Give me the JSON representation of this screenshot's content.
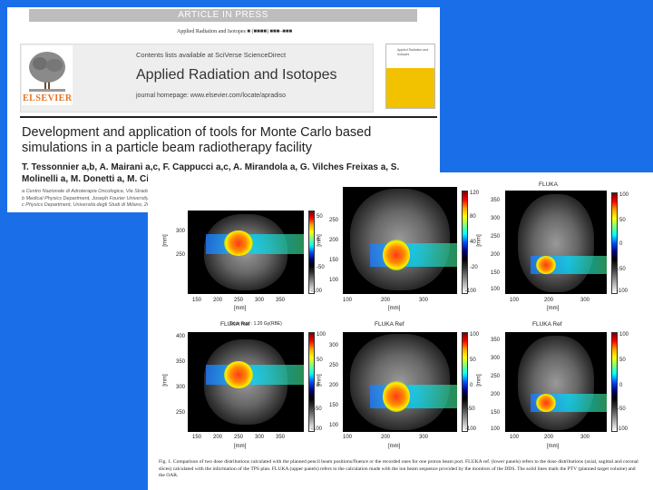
{
  "header": {
    "press_label": "ARTICLE IN PRESS",
    "journal_ref": "Applied Radiation and Isotopes ■ (■■■■) ■■■–■■■",
    "publisher": "ELSEVIER",
    "contents_line": "Contents lists available at SciVerse ScienceDirect",
    "journal_title": "Applied Radiation and Isotopes",
    "journal_homepage": "journal homepage: www.elsevier.com/locate/apradiso",
    "cover_text": "Applied Radiation and Isotopes"
  },
  "article": {
    "title": "Development and application of tools for Monte Carlo based simulations in a particle beam radiotherapy facility",
    "authors": "T. Tessonnier a,b, A. Mairani a,c, F. Cappucci a,c, A. Mirandola a, G. Vilches Freixas a, S. Molinelli a, M. Donetti a, M. Ciocca a",
    "affiliations": [
      "a Centro Nazionale di Adroterapia Oncologica, Via Strada Campeggi 53, 27100 Pavia, Italy",
      "b Medical Physics Department, Joseph Fourier University, 38000 Grenoble, France",
      "c Physics Department, Università degli Studi di Milano, 20122 Milano, Italy"
    ]
  },
  "figure": {
    "top_right_title": "FLUKA",
    "bottom_titles": [
      "FLUKA Ref",
      "FLUKA Ref",
      "FLUKA Ref"
    ],
    "dose_note": "Dose max : 1.20 Gy(RBE)",
    "unit_mm": "[mm]",
    "panels": [
      {
        "yticks": [
          "300",
          "250"
        ],
        "xticks": [
          "150",
          "200",
          "250",
          "300",
          "350"
        ],
        "cbar": [
          "50",
          "0",
          "-50",
          "-100"
        ]
      },
      {
        "yticks": [
          "300",
          "250",
          "200",
          "150",
          "100"
        ],
        "xticks": [
          "100",
          "200",
          "300"
        ],
        "cbar": [
          "120",
          "100",
          "80",
          "60",
          "40",
          "20",
          "0",
          "-20",
          "-40",
          "-60",
          "-80",
          "-100"
        ]
      },
      {
        "yticks": [
          "350",
          "300",
          "250",
          "200",
          "150",
          "100"
        ],
        "xticks": [
          "100",
          "200",
          "300"
        ],
        "cbar": [
          "100",
          "50",
          "0",
          "-50",
          "-100"
        ]
      },
      {
        "yticks": [
          "400",
          "350",
          "300",
          "250"
        ],
        "xticks": [
          "150",
          "200",
          "250",
          "300",
          "350"
        ],
        "cbar": [
          "100",
          "50",
          "0",
          "-50",
          "-100"
        ]
      },
      {
        "yticks": [
          "300",
          "250",
          "200",
          "150",
          "100"
        ],
        "xticks": [
          "100",
          "200",
          "300"
        ],
        "cbar": [
          "100",
          "50",
          "0",
          "-50",
          "-100"
        ]
      },
      {
        "yticks": [
          "350",
          "300",
          "250",
          "200",
          "150",
          "100"
        ],
        "xticks": [
          "100",
          "200",
          "300"
        ],
        "cbar": [
          "100",
          "50",
          "0",
          "-50",
          "-100"
        ]
      }
    ],
    "caption": "Fig. 1. Comparison of two dose distributions calculated with the planned pencil beam positions/fluence or the recorded ones for one proton beam port. FLUKA ref. (lower panels) refers to the dose distributions (axial, sagittal and coronal slices) calculated with the information of the TPS plan. FLUKA (upper panels) refers to the calculation made with the ion beam sequence provided by the monitors of the DDS. The solid lines mark the PTV (planned target volume) and the OAR."
  },
  "colors": {
    "background": "#1a6fe8",
    "publisher_orange": "#e9711c",
    "cover_yellow": "#f2c200"
  }
}
